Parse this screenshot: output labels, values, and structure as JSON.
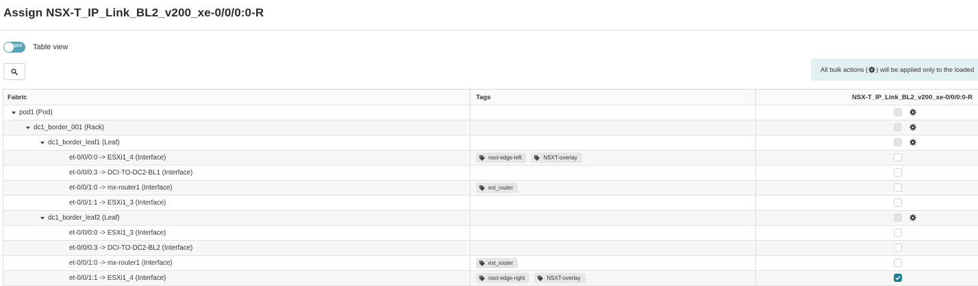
{
  "page": {
    "title": "Assign NSX-T_IP_Link_BL2_v200_xe-0/0/0:0-R"
  },
  "toolbar": {
    "toggle_state": "OFF",
    "toggle_label": "Table view",
    "search_icon": "search-icon"
  },
  "notice": {
    "text_before": "All bulk actions (",
    "text_after": ") will be applied only to the loaded"
  },
  "table": {
    "headers": [
      "Fabric",
      "Tags",
      "NSX-T_IP_Link_BL2_v200_xe-0/0/0:0-R"
    ],
    "rows": [
      {
        "label": "pod1 (Pod)",
        "level": 1,
        "expandable": true,
        "tags": [],
        "checkbox": "disabled",
        "gear": true
      },
      {
        "label": "dc1_border_001 (Rack)",
        "level": 2,
        "expandable": true,
        "tags": [],
        "checkbox": "disabled",
        "gear": true
      },
      {
        "label": "dc1_border_leaf1 (Leaf)",
        "level": 3,
        "expandable": true,
        "tags": [],
        "checkbox": "disabled",
        "gear": true
      },
      {
        "label": "et-0/0/0:0 -> ESXi1_4 (Interface)",
        "level": 4,
        "expandable": false,
        "tags": [
          "nsxt-edge-left",
          "NSXT-overlay"
        ],
        "checkbox": "unchecked",
        "gear": false
      },
      {
        "label": "et-0/0/0:3 -> DCI-TO-DC2-BL1 (Interface)",
        "level": 4,
        "expandable": false,
        "tags": [],
        "checkbox": "unchecked",
        "gear": false
      },
      {
        "label": "et-0/0/1:0 -> mx-router1 (Interface)",
        "level": 4,
        "expandable": false,
        "tags": [
          "ext_router"
        ],
        "checkbox": "unchecked",
        "gear": false
      },
      {
        "label": "et-0/0/1:1 -> ESXi1_3 (Interface)",
        "level": 4,
        "expandable": false,
        "tags": [],
        "checkbox": "unchecked",
        "gear": false
      },
      {
        "label": "dc1_border_leaf2 (Leaf)",
        "level": 3,
        "expandable": true,
        "tags": [],
        "checkbox": "disabled",
        "gear": true
      },
      {
        "label": "et-0/0/0:0 -> ESXi1_3 (Interface)",
        "level": 4,
        "expandable": false,
        "tags": [],
        "checkbox": "unchecked",
        "gear": false
      },
      {
        "label": "et-0/0/0:3 -> DCI-TO-DC2-BL2 (Interface)",
        "level": 4,
        "expandable": false,
        "tags": [],
        "checkbox": "unchecked",
        "gear": false
      },
      {
        "label": "et-0/0/1:0 -> mx-router1 (Interface)",
        "level": 4,
        "expandable": false,
        "tags": [
          "ext_router"
        ],
        "checkbox": "unchecked",
        "gear": false
      },
      {
        "label": "et-0/0/1:1 -> ESXi1_4 (Interface)",
        "level": 4,
        "expandable": false,
        "tags": [
          "nsxt-edge-right",
          "NSXT-overlay"
        ],
        "checkbox": "checked",
        "gear": false
      }
    ]
  },
  "colors": {
    "accent": "#1f7f93",
    "toggle": "#5aa2b7",
    "notice_bg": "#e3f0f2"
  }
}
